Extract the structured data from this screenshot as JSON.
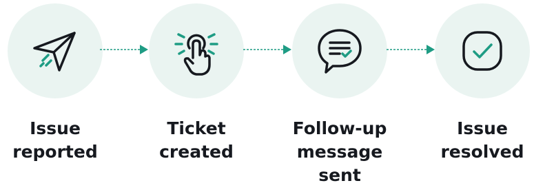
{
  "colors": {
    "circle_fill": "#EAF4F1",
    "icon_stroke": "#16191F",
    "accent": "#1E9C84",
    "arrow": "#1E9C84",
    "text": "#16191F"
  },
  "steps": [
    {
      "icon": "paper-plane-icon",
      "label_lines": [
        "Issue",
        "reported"
      ]
    },
    {
      "icon": "tap-hand-icon",
      "label_lines": [
        "Ticket",
        "created"
      ]
    },
    {
      "icon": "chat-message-icon",
      "label_lines": [
        "Follow-up",
        "message",
        "sent"
      ]
    },
    {
      "icon": "checkmark-circle-icon",
      "label_lines": [
        "Issue",
        "resolved"
      ]
    }
  ]
}
